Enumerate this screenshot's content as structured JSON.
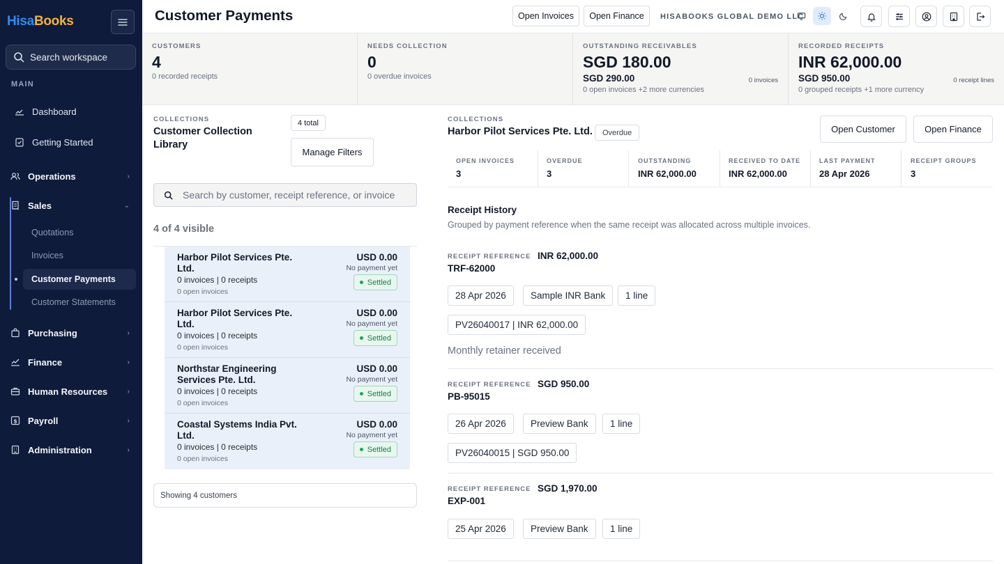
{
  "brand": {
    "part1": "Hisa",
    "part2": "Books"
  },
  "sidebar": {
    "search_label": "Search workspace",
    "section_label": "MAIN",
    "items": [
      {
        "label": "Dashboard"
      },
      {
        "label": "Getting Started"
      },
      {
        "label": "Operations"
      },
      {
        "label": "Sales"
      },
      {
        "label": "Purchasing"
      },
      {
        "label": "Finance"
      },
      {
        "label": "Human Resources"
      },
      {
        "label": "Payroll"
      },
      {
        "label": "Administration"
      }
    ],
    "sales_subitems": [
      {
        "label": "Quotations"
      },
      {
        "label": "Invoices"
      },
      {
        "label": "Customer Payments"
      },
      {
        "label": "Customer Statements"
      }
    ]
  },
  "header": {
    "title": "Customer Payments",
    "open_invoices": "Open Invoices",
    "open_finance": "Open Finance",
    "org_name": "HISABOOKS GLOBAL DEMO LLC"
  },
  "stats": [
    {
      "label": "CUSTOMERS",
      "value": "4",
      "note": "0 recorded receipts"
    },
    {
      "label": "NEEDS COLLECTION",
      "value": "0",
      "note": "0 overdue invoices"
    },
    {
      "label": "OUTSTANDING RECEIVABLES",
      "value": "SGD 180.00",
      "secondary": "SGD 290.00",
      "note": "0 open invoices +2 more currencies",
      "right": "0 invoices"
    },
    {
      "label": "RECORDED RECEIPTS",
      "value": "INR 62,000.00",
      "secondary": "SGD 950.00",
      "note": "0 grouped receipts +1 more currency",
      "right": "0 receipt lines"
    }
  ],
  "library": {
    "kicker": "COLLECTIONS",
    "title": "Customer Collection Library",
    "total_badge": "4 total",
    "manage_filters": "Manage Filters",
    "search_placeholder": "Search by customer, receipt reference, or invoice",
    "visible_count": "4 of 4 visible",
    "showing": "Showing 4 customers",
    "customers": [
      {
        "name": "Harbor Pilot Services Pte. Ltd.",
        "amount": "USD 0.00",
        "payment": "No payment yet",
        "status": "Settled",
        "meta": "0 invoices | 0 receipts",
        "open": "0 open invoices"
      },
      {
        "name": "Harbor Pilot Services Pte. Ltd.",
        "amount": "USD 0.00",
        "payment": "No payment yet",
        "status": "Settled",
        "meta": "0 invoices | 0 receipts",
        "open": "0 open invoices"
      },
      {
        "name": "Northstar Engineering Services Pte. Ltd.",
        "amount": "USD 0.00",
        "payment": "No payment yet",
        "status": "Settled",
        "meta": "0 invoices | 0 receipts",
        "open": "0 open invoices"
      },
      {
        "name": "Coastal Systems India Pvt. Ltd.",
        "amount": "USD 0.00",
        "payment": "No payment yet",
        "status": "Settled",
        "meta": "0 invoices | 0 receipts",
        "open": "0 open invoices"
      }
    ]
  },
  "detail": {
    "kicker": "COLLECTIONS",
    "title": "Harbor Pilot Services Pte. Ltd.",
    "status": "Overdue",
    "open_customer": "Open Customer",
    "open_finance": "Open Finance",
    "metrics": [
      {
        "label": "OPEN INVOICES",
        "value": "3"
      },
      {
        "label": "OVERDUE",
        "value": "3"
      },
      {
        "label": "OUTSTANDING",
        "value": "INR 62,000.00"
      },
      {
        "label": "RECEIVED TO DATE",
        "value": "INR 62,000.00"
      },
      {
        "label": "LAST PAYMENT",
        "value": "28 Apr 2026"
      },
      {
        "label": "RECEIPT GROUPS",
        "value": "3"
      }
    ],
    "history_title": "Receipt History",
    "history_subtitle": "Grouped by payment reference when the same receipt was allocated across multiple invoices.",
    "receipt_label": "RECEIPT REFERENCE",
    "receipts": [
      {
        "amount": "INR 62,000.00",
        "reference": "TRF-62000",
        "date": "28 Apr 2026",
        "bank": "Sample INR Bank",
        "lines": "1 line",
        "allocation": "PV26040017 | INR 62,000.00",
        "note": "Monthly retainer received"
      },
      {
        "amount": "SGD 950.00",
        "reference": "PB-95015",
        "date": "26 Apr 2026",
        "bank": "Preview Bank",
        "lines": "1 line",
        "allocation": "PV26040015 | SGD 950.00"
      },
      {
        "amount": "SGD 1,970.00",
        "reference": "EXP-001",
        "date": "25 Apr 2026",
        "bank": "Preview Bank",
        "lines": "1 line"
      }
    ]
  }
}
